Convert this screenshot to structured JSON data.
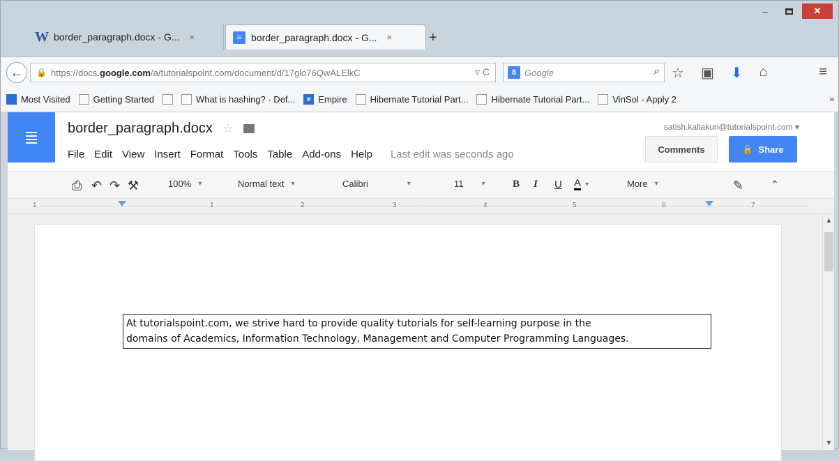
{
  "browser": {
    "tabs": [
      {
        "title": "border_paragraph.docx - G...",
        "close": "×"
      },
      {
        "title": "border_paragraph.docx - G...",
        "close": "×"
      }
    ],
    "new_tab": "+",
    "url_prefix": "https://docs.",
    "url_host": "google.com",
    "url_rest": "/a/tutorialspoint.com/document/d/17glo76QwALElkC",
    "url_tail": "▿ C",
    "search_placeholder": "Google",
    "search_engine_icon": "8",
    "bookmarks": [
      "Most Visited",
      "Getting Started",
      "What is hashing? - Def...",
      "Empire",
      "Hibernate Tutorial Part...",
      "Hibernate Tutorial Part...",
      "VinSol - Apply 2"
    ],
    "bookmarks_more": "»",
    "window_controls": {
      "minimize": "–",
      "close": "✕"
    }
  },
  "docs": {
    "title": "border_paragraph.docx",
    "user": "satish.kallakuri@tutorialspoint.com ▾",
    "menu": [
      "File",
      "Edit",
      "View",
      "Insert",
      "Format",
      "Tools",
      "Table",
      "Add-ons",
      "Help"
    ],
    "last_edit": "Last edit was seconds ago",
    "comments_label": "Comments",
    "share_label": "Share",
    "toolbar": {
      "zoom": "100%",
      "style": "Normal text",
      "font": "Calibri",
      "size": "11",
      "bold": "B",
      "italic": "I",
      "underline": "U",
      "color": "A",
      "more": "More"
    },
    "ruler": [
      "1",
      "1",
      "2",
      "3",
      "4",
      "5",
      "6",
      "7"
    ],
    "paragraph_line1": "At tutorialspoint.com, we strive hard to provide quality tutorials for self-learning purpose in the",
    "paragraph_line2": "domains of Academics, Information Technology, Management and Computer Programming Languages."
  },
  "colors": {
    "accent": "#4285f4",
    "close": "#c9403a"
  }
}
